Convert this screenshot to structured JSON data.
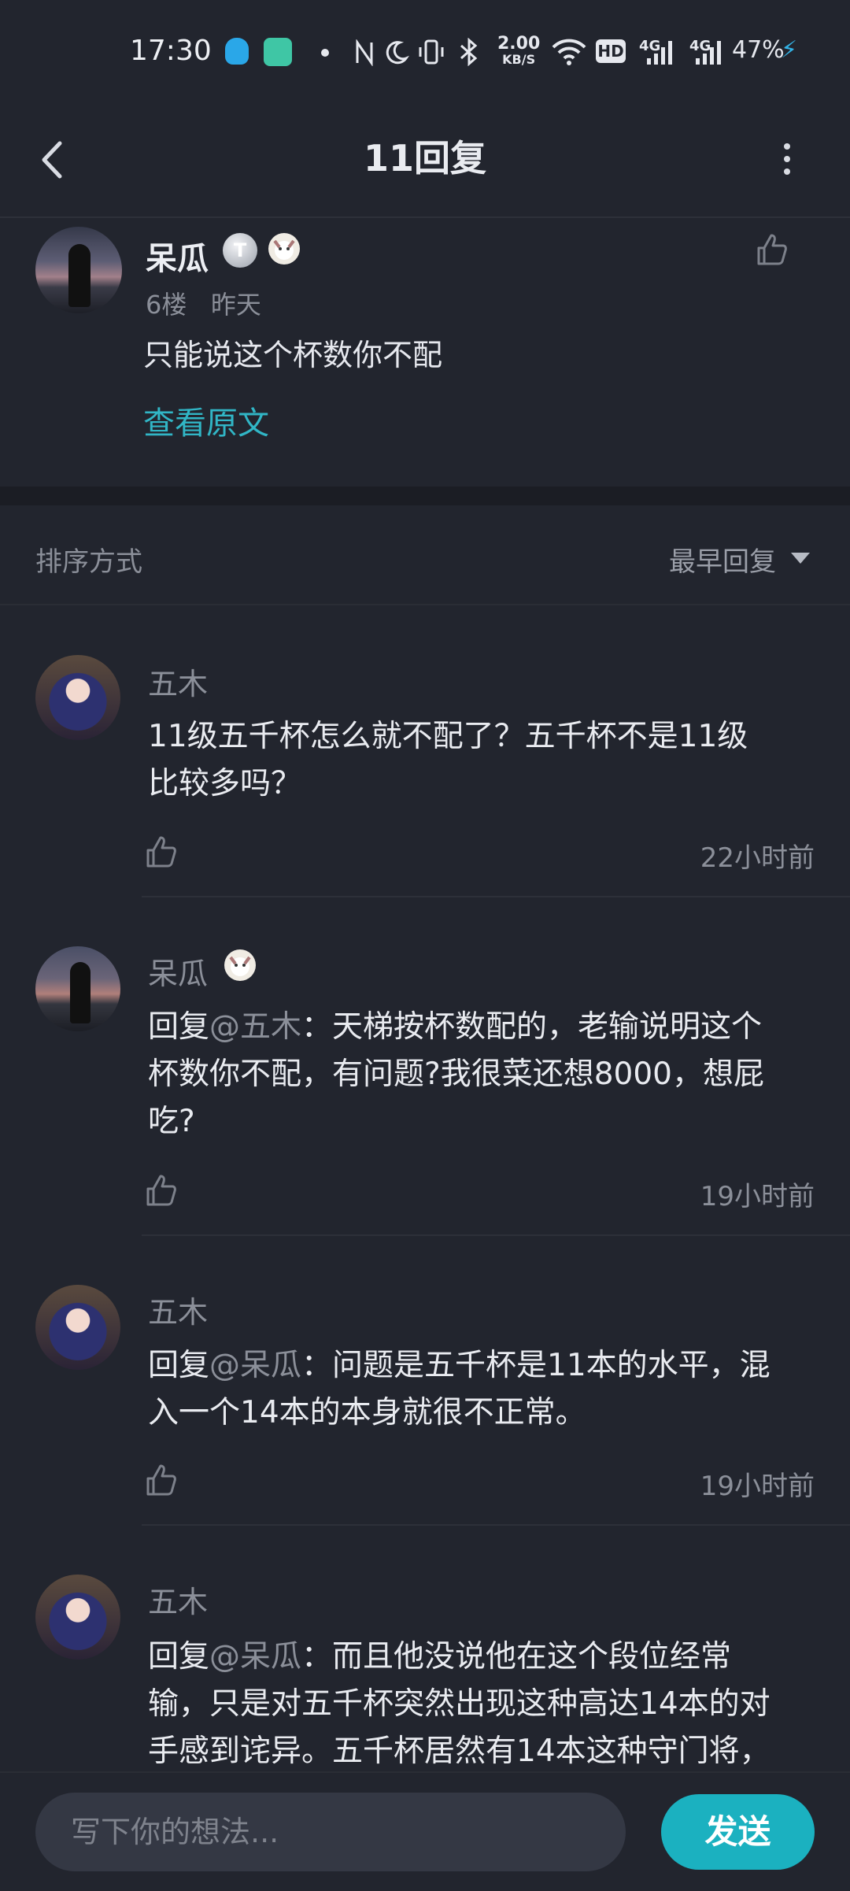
{
  "status_bar": {
    "time": "17:30",
    "net_speed_value": "2.00",
    "net_speed_unit": "KB/S",
    "hd_label": "HD",
    "signal1_label": "4G",
    "signal2_label": "4G",
    "battery_percent": "47%"
  },
  "header": {
    "title": "11回复"
  },
  "original_post": {
    "author": "呆瓜",
    "level_badge": "T",
    "floor": "6楼",
    "time": "昨天",
    "content": "只能说这个杯数你不配",
    "view_original_label": "查看原文"
  },
  "sort": {
    "label": "排序方式",
    "value": "最早回复"
  },
  "replies": [
    {
      "author": "五木",
      "content_lines": [
        "11级五千杯怎么就不配了？五千杯不是11级",
        "比较多吗？"
      ],
      "time": "22小时前"
    },
    {
      "author": "呆瓜",
      "reply_prefix": "回复",
      "reply_target": "@五木",
      "content_lines": [
        "：天梯按杯数配的，老输说明这个",
        "杯数你不配，有问题?我很菜还想8000，想屁",
        "吃?"
      ],
      "time": "19小时前"
    },
    {
      "author": "五木",
      "reply_prefix": "回复",
      "reply_target": "@呆瓜",
      "content_lines": [
        "：问题是五千杯是11本的水平，混",
        "入一个14本的本身就很不正常。"
      ],
      "time": "19小时前"
    },
    {
      "author": "五木",
      "reply_prefix": "回复",
      "reply_target": "@呆瓜",
      "content_lines": [
        "：而且他没说他在这个段位经常",
        "输，只是对五千杯突然出现这种高达14本的对",
        "手感到诧异。五千杯居然有14本这种守门将，"
      ],
      "time": ""
    }
  ],
  "composer": {
    "placeholder": "写下你的想法...",
    "send_label": "发送"
  },
  "colors": {
    "background": "#22252e",
    "accent": "#1bb1c0",
    "link": "#31b6c6"
  }
}
